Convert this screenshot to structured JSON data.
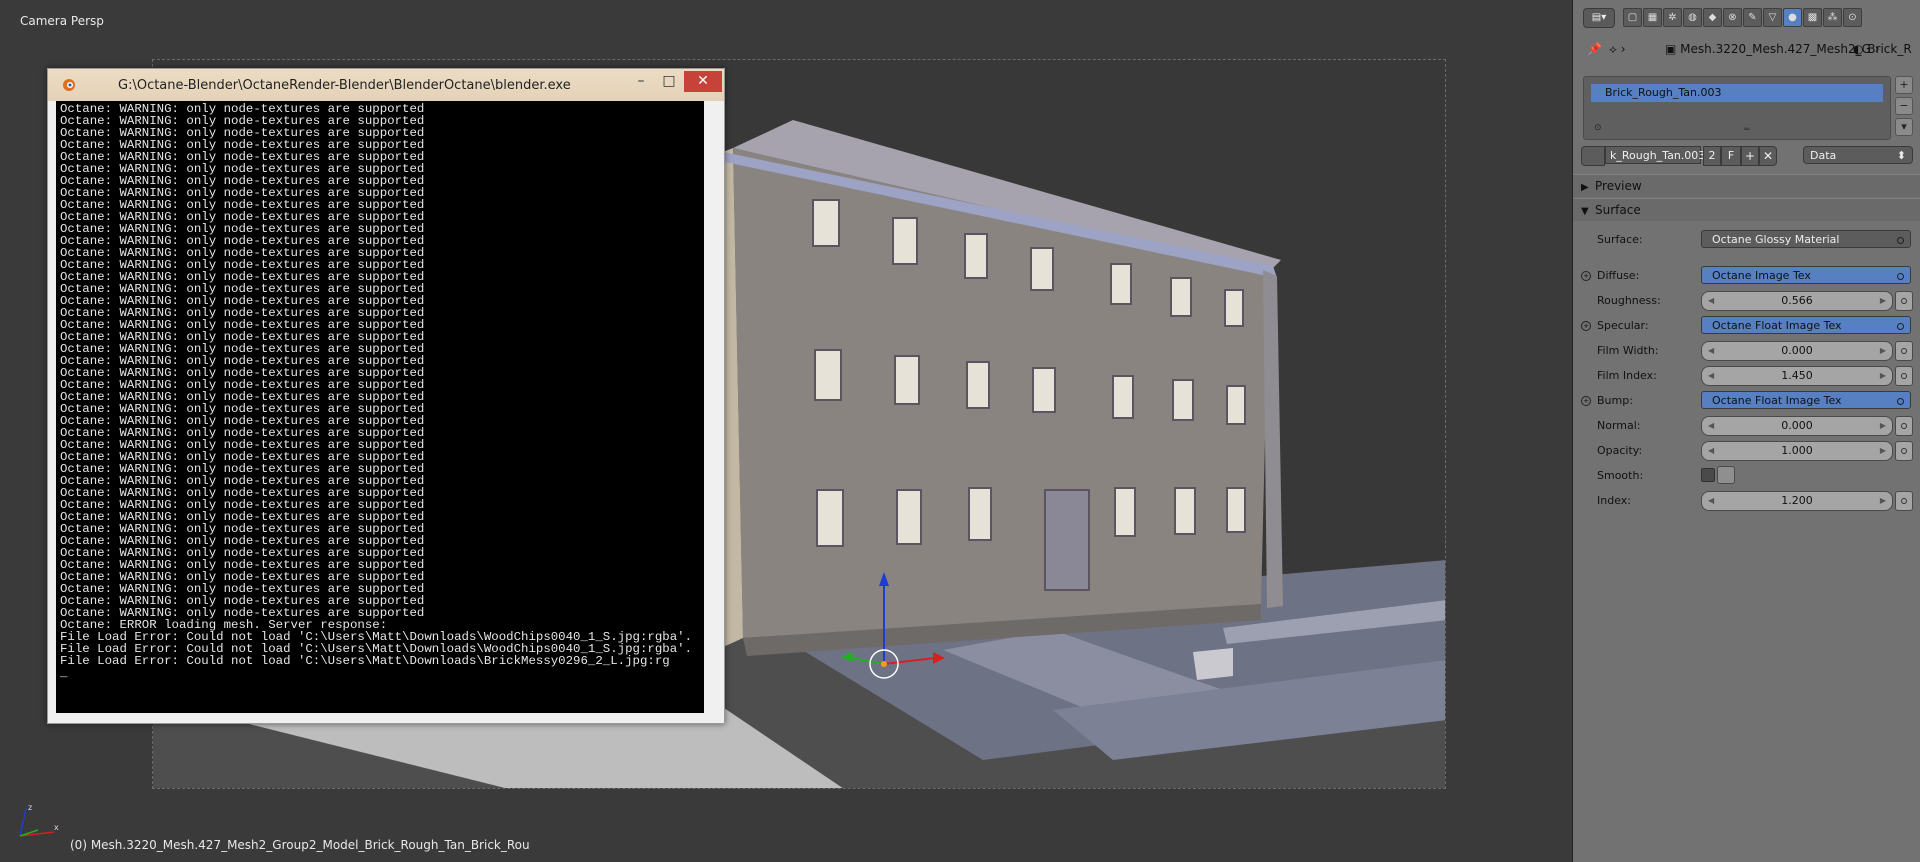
{
  "viewport": {
    "title": "Camera Persp",
    "status": "(0) Mesh.3220_Mesh.427_Mesh2_Group2_Model_Brick_Rough_Tan_Brick_Rou",
    "axis_x": "x",
    "axis_z": "z"
  },
  "console": {
    "title": "G:\\Octane-Blender\\OctaneRender-Blender\\BlenderOctane\\blender.exe",
    "minimize": "–",
    "maximize": "□",
    "close": "✕",
    "scroll_up": "▲",
    "scroll_down": "▼",
    "warning_line": "Octane: WARNING: only node-textures are supported",
    "warning_count": 43,
    "tail": "Octane: ERROR loading mesh. Server response:\nFile Load Error: Could not load 'C:\\Users\\Matt\\Downloads\\WoodChips0040_1_S.jpg:rgba'.\nFile Load Error: Could not load 'C:\\Users\\Matt\\Downloads\\WoodChips0040_1_S.jpg:rgba'.\nFile Load Error: Could not load 'C:\\Users\\Matt\\Downloads\\BrickMessy0296_2_L.jpg:rg\n_"
  },
  "properties": {
    "editor_type_icon": "properties-icon",
    "tabs": [
      "render",
      "render-layers",
      "scene",
      "world",
      "object",
      "constraints",
      "modifiers",
      "data",
      "material",
      "texture",
      "particles",
      "physics"
    ],
    "active_tab": "material",
    "breadcrumb": {
      "pin": "📌",
      "mesh": "Mesh.3220_Mesh.427_Mesh2_G",
      "material": "Brick_R"
    },
    "material_slot": "Brick_Rough_Tan.003",
    "material_name": "k_Rough_Tan.003",
    "material_users": "2",
    "fake_user": "F",
    "new_button": "+",
    "unlink_button": "✕",
    "link": "Data",
    "preview_label": "Preview",
    "surface_panel": "Surface",
    "surface_label": "Surface:",
    "surface_value": "Octane Glossy Material",
    "diffuse_label": "Diffuse:",
    "diffuse_value": "Octane Image Tex",
    "roughness_label": "Roughness:",
    "roughness_value": "0.566",
    "specular_label": "Specular:",
    "specular_value": "Octane Float Image Tex",
    "filmwidth_label": "Film Width:",
    "filmwidth_value": "0.000",
    "filmindex_label": "Film Index:",
    "filmindex_value": "1.450",
    "bump_label": "Bump:",
    "bump_value": "Octane Float Image Tex",
    "normal_label": "Normal:",
    "normal_value": "0.000",
    "opacity_label": "Opacity:",
    "opacity_value": "1.000",
    "smooth_label": "Smooth:",
    "index_label": "Index:",
    "index_value": "1.200"
  }
}
